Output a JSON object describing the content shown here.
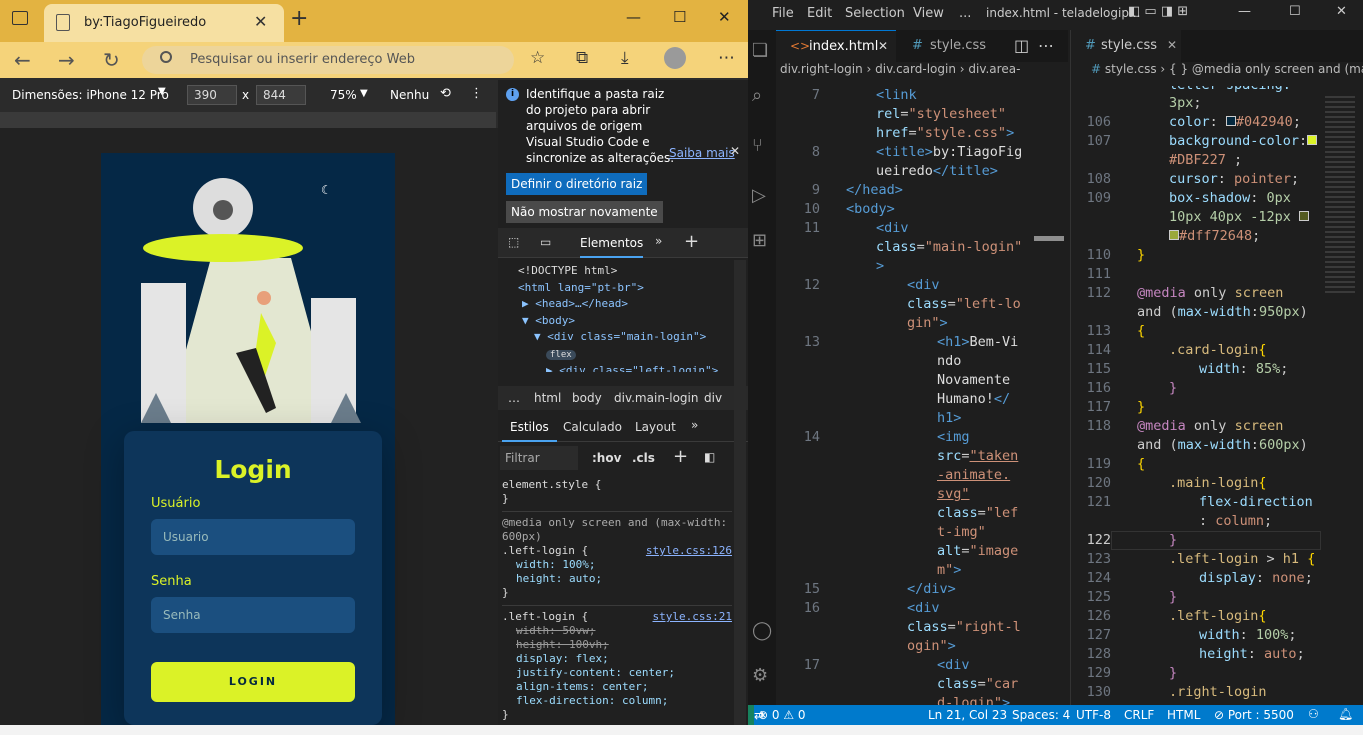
{
  "browser": {
    "tab_title": "by:TiagoFigueiredo",
    "address_placeholder": "Pesquisar ou inserir endereço Web",
    "device_label": "Dimensões: iPhone 12 Pro",
    "width_value": "390",
    "height_value": "844",
    "times": "x",
    "zoom": "75%",
    "throttle": "Nenhu"
  },
  "page": {
    "heading": "Login",
    "user_label": "Usuário",
    "user_placeholder": "Usuario",
    "pass_label": "Senha",
    "pass_placeholder": "Senha",
    "button": "LOGIN"
  },
  "devtools": {
    "info_text": "Identifique a pasta raiz do projeto para abrir arquivos de origem Visual Studio Code e sincronize as alterações.",
    "learn_more": "Saiba mais",
    "set_root": "Definir o diretório raiz",
    "dont_show": "Não mostrar novamente",
    "tab_elements": "Elementos",
    "dom": [
      "<!DOCTYPE html>",
      "<html lang=\"pt-br\">",
      "▶ <head>…</head>",
      "▼ <body>",
      "▼ <div class=\"main-login\">",
      "▶ <div class=\"left-login\">"
    ],
    "flex_badge": "flex",
    "crumbs": [
      "html",
      "body",
      "div.main-login",
      "div"
    ],
    "style_tabs": [
      "Estilos",
      "Calculado",
      "Layout"
    ],
    "filter": "Filtrar",
    "hov": ":hov",
    "cls": ".cls",
    "rules": [
      {
        "selector": "element.style {",
        "source": "",
        "props": []
      },
      {
        "selector": ".left-login {",
        "media": "@media only screen and (max-width: 600px)",
        "source": "style.css:126",
        "props": [
          "width: 100%;",
          "height: auto;"
        ]
      },
      {
        "selector": ".left-login {",
        "source": "style.css:21",
        "props": [
          "width: 50vw;",
          "height: 100vh;",
          "display: flex;",
          "justify-content: center;",
          "align-items: center;",
          "flex-direction: column;"
        ]
      }
    ]
  },
  "vscode": {
    "menu": [
      "File",
      "Edit",
      "Selection",
      "View",
      "..."
    ],
    "title": "index.html - teladelogip...",
    "tab_left_active": "index.html",
    "tab_left_other": "style.css",
    "tab_right": "style.css",
    "breadcrumb_left": [
      "div.right-login",
      "div.card-login",
      "div.area-"
    ],
    "breadcrumb_right": [
      "style.css",
      "{ } @media only screen",
      "and (max"
    ],
    "status": {
      "problems": "⊗ 0 ⚠ 0",
      "position": "Ln 21, Col 23",
      "spaces": "Spaces: 4",
      "encoding": "UTF-8",
      "eol": "CRLF",
      "lang": "HTML",
      "port": "⊘ Port : 5500"
    }
  },
  "colors": {
    "accent": "#dbf227",
    "dark": "#042940",
    "edge": "#e3b341",
    "status": "#007acc"
  }
}
